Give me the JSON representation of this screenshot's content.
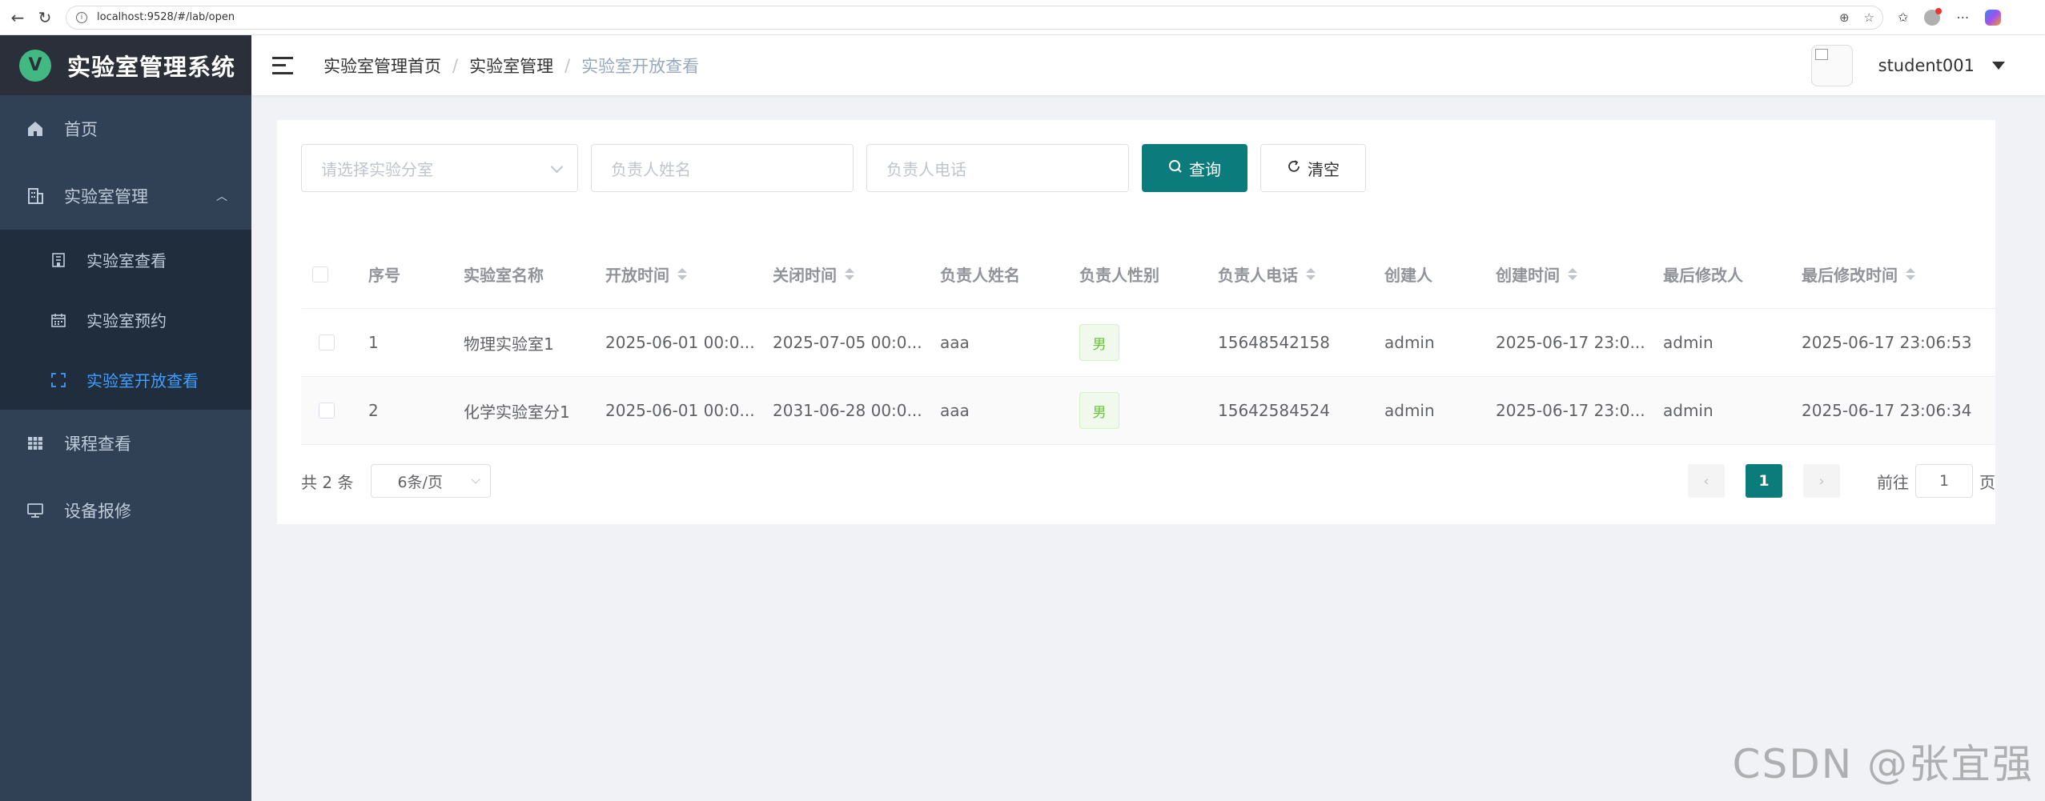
{
  "browser": {
    "url": "localhost:9528/#/lab/open"
  },
  "sidebar": {
    "logo_letter": "V",
    "title": "实验室管理系统",
    "items": [
      {
        "label": "首页"
      },
      {
        "label": "实验室管理",
        "expanded": true
      },
      {
        "label": "课程查看"
      },
      {
        "label": "设备报修"
      }
    ],
    "submenu": [
      {
        "label": "实验室查看"
      },
      {
        "label": "实验室预约"
      },
      {
        "label": "实验室开放查看",
        "active": true
      }
    ],
    "active_color": "#409eff",
    "bg_color": "#304156"
  },
  "header": {
    "breadcrumb": [
      "实验室管理首页",
      "实验室管理",
      "实验室开放查看"
    ],
    "user_name": "student001"
  },
  "filters": {
    "lab_placeholder": "请选择实验分室",
    "name_placeholder": "负责人姓名",
    "phone_placeholder": "负责人电话",
    "search_label": "查询",
    "clear_label": "清空",
    "primary_color": "#0c7b7b"
  },
  "table": {
    "columns": [
      "序号",
      "实验室名称",
      "开放时间",
      "关闭时间",
      "负责人姓名",
      "负责人性别",
      "负责人电话",
      "创建人",
      "创建时间",
      "最后修改人",
      "最后修改时间"
    ],
    "rows": [
      {
        "index": "1",
        "name": "物理实验室1",
        "open": "2025-06-01 00:0...",
        "close": "2025-07-05 00:0...",
        "owner": "aaa",
        "gender": "男",
        "phone": "15648542158",
        "creator": "admin",
        "created": "2025-06-17 23:0...",
        "modifier": "admin",
        "modified": "2025-06-17 23:06:53"
      },
      {
        "index": "2",
        "name": "化学实验室分1",
        "open": "2025-06-01 00:0...",
        "close": "2031-06-28 00:0...",
        "owner": "aaa",
        "gender": "男",
        "phone": "15642584524",
        "creator": "admin",
        "created": "2025-06-17 23:0...",
        "modifier": "admin",
        "modified": "2025-06-17 23:06:34"
      }
    ]
  },
  "pagination": {
    "total": "共 2 条",
    "page_size": "6条/页",
    "current_page": "1",
    "goto_prefix": "前往",
    "goto_value": "1",
    "goto_suffix": "页"
  },
  "watermark": "CSDN @张宜强"
}
